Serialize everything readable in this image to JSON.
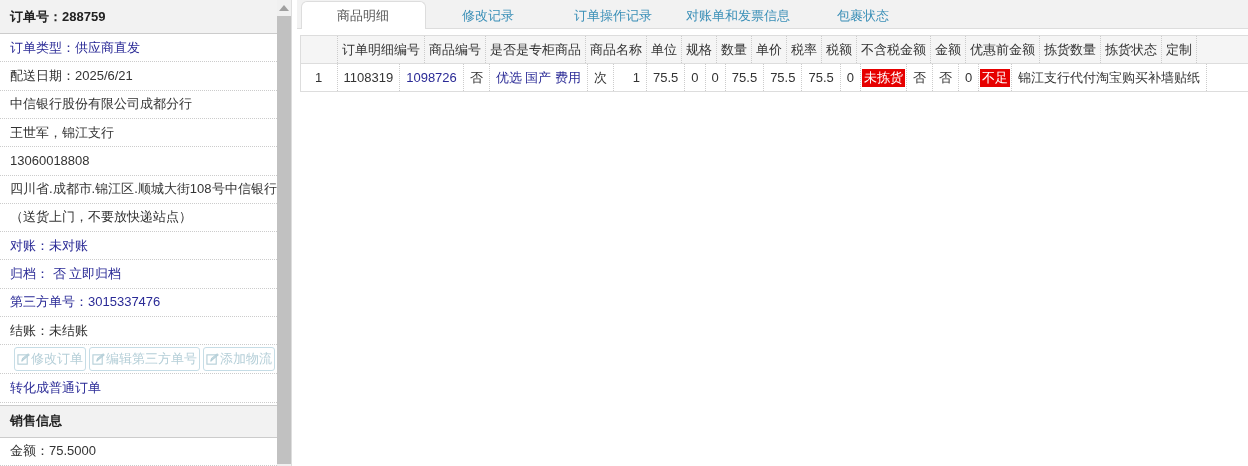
{
  "order_panel": {
    "title": "订单号：288759",
    "rows": [
      {
        "text": "订单类型：供应商直发",
        "kind": "link"
      },
      {
        "text": "配送日期：2025/6/21",
        "kind": "plain"
      },
      {
        "text": "中信银行股份有限公司成都分行",
        "kind": "plain"
      },
      {
        "text": "王世军，锦江支行",
        "kind": "plain"
      },
      {
        "text": "13060018808",
        "kind": "plain"
      },
      {
        "text": "四川省.成都市.锦江区.顺城大街108号中信银行",
        "kind": "plain"
      },
      {
        "text": "（送货上门，不要放快递站点）",
        "kind": "plain"
      },
      {
        "text": "对账：未对账",
        "kind": "link"
      },
      {
        "text": "归档：  否 立即归档",
        "kind": "link"
      },
      {
        "text": "第三方单号：3015337476",
        "kind": "link"
      },
      {
        "text": "结账：未结账",
        "kind": "plain"
      }
    ],
    "buttons": [
      {
        "label": "修改订单",
        "disabled": true
      },
      {
        "label": "编辑第三方单号",
        "disabled": true
      },
      {
        "label": "添加物流",
        "disabled": true
      }
    ],
    "convert_link": "转化成普通订单",
    "section_title": "销售信息",
    "amount": "金额：75.5000"
  },
  "tabs": [
    {
      "label": "商品明细",
      "selected": true
    },
    {
      "label": "修改记录",
      "selected": false
    },
    {
      "label": "订单操作记录",
      "selected": false
    },
    {
      "label": "对账单和发票信息",
      "selected": false
    },
    {
      "label": "包裹状态",
      "selected": false
    }
  ],
  "item_list": {
    "header_labels": [
      "订单明细编号",
      "商品编号",
      "是否是专柜商品",
      "商品名称",
      "单位",
      "规格",
      "数量",
      "单价",
      "税率",
      "税额",
      "不含税金额",
      "金额",
      "优惠前金额",
      "拣货数量",
      "拣货状态",
      "定制"
    ],
    "lines": [
      {
        "number": "1",
        "values": [
          {
            "text": "1108319",
            "kind": "plain"
          },
          {
            "text": "1098726",
            "kind": "link"
          },
          {
            "text": "否",
            "kind": "plain"
          },
          {
            "text": "优选 国产 费用",
            "kind": "link"
          },
          {
            "text": "次",
            "kind": "plain"
          },
          {
            "text": "1",
            "kind": "wide"
          },
          {
            "text": "75.5",
            "kind": "plain"
          },
          {
            "text": "0",
            "kind": "plain"
          },
          {
            "text": "0",
            "kind": "plain"
          },
          {
            "text": "75.5",
            "kind": "plain"
          },
          {
            "text": "75.5",
            "kind": "plain"
          },
          {
            "text": "75.5",
            "kind": "plain"
          },
          {
            "text": "0",
            "kind": "plain"
          },
          {
            "text": "未拣货",
            "kind": "alert"
          },
          {
            "text": "否",
            "kind": "plain"
          },
          {
            "text": "否",
            "kind": "plain"
          },
          {
            "text": "0",
            "kind": "plain"
          },
          {
            "text": "不足",
            "kind": "alert"
          },
          {
            "text": "锦江支行代付淘宝购买补墙贴纸",
            "kind": "plain"
          }
        ]
      }
    ]
  }
}
